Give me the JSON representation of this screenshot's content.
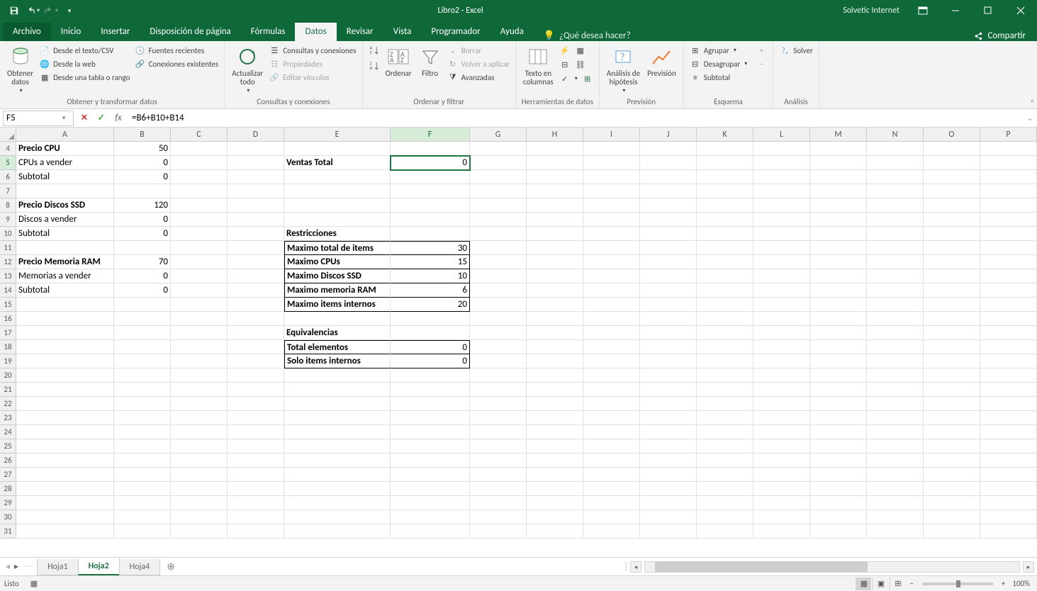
{
  "app": {
    "title": "Libro2 - Excel",
    "user": "Solvetic Internet"
  },
  "tabs": {
    "archivo": "Archivo",
    "inicio": "Inicio",
    "insertar": "Insertar",
    "diseno": "Disposición de página",
    "formulas": "Fórmulas",
    "datos": "Datos",
    "revisar": "Revisar",
    "vista": "Vista",
    "programador": "Programador",
    "ayuda": "Ayuda",
    "tellme": "¿Qué desea hacer?",
    "compartir": "Compartir"
  },
  "ribbon": {
    "obtener": {
      "obtener": "Obtener\ndatos",
      "csv": "Desde el texto/CSV",
      "web": "Desde la web",
      "tabla": "Desde una tabla o rango",
      "recientes": "Fuentes recientes",
      "existentes": "Conexiones existentes",
      "label": "Obtener y transformar datos"
    },
    "conex": {
      "actualizar": "Actualizar\ntodo",
      "consultas": "Consultas y conexiones",
      "props": "Propiedades",
      "vinculos": "Editar vínculos",
      "label": "Consultas y conexiones"
    },
    "ordenar_filtrar": {
      "ordenar": "Ordenar",
      "filtro": "Filtro",
      "borrar": "Borrar",
      "reaplicar": "Volver a aplicar",
      "avanzadas": "Avanzadas",
      "label": "Ordenar y filtrar"
    },
    "herramientas": {
      "texto": "Texto en\ncolumnas",
      "label": "Herramientas de datos"
    },
    "prevision": {
      "analisis": "Análisis de\nhipótesis",
      "prev": "Previsión",
      "label": "Previsión"
    },
    "esquema": {
      "agrupar": "Agrupar",
      "desagrupar": "Desagrupar",
      "subtotal": "Subtotal",
      "label": "Esquema"
    },
    "analisis_g": {
      "solver": "Solver",
      "label": "Análisis"
    }
  },
  "name_box": "F5",
  "formula": "=B6+B10+B14",
  "columns": [
    "A",
    "B",
    "C",
    "D",
    "E",
    "F",
    "G",
    "H",
    "I",
    "J",
    "K",
    "L",
    "M",
    "N",
    "O",
    "P"
  ],
  "col_widths": {
    "A": 138,
    "E": 150,
    "F": 112,
    "default": 80
  },
  "visible_rows": [
    4,
    5,
    6,
    7,
    8,
    9,
    10,
    11,
    12,
    13,
    14,
    15,
    16,
    17,
    18,
    19,
    20,
    21,
    22,
    23,
    24,
    25,
    26,
    27,
    28,
    29,
    30,
    31
  ],
  "selected_cell": {
    "row": 5,
    "col": "F"
  },
  "cells": {
    "A4": {
      "v": "Precio CPU",
      "b": 1
    },
    "B4": {
      "v": "50",
      "n": 1
    },
    "A5": {
      "v": "CPUs a vender"
    },
    "B5": {
      "v": "0",
      "n": 1
    },
    "E5": {
      "v": "Ventas Total",
      "b": 1
    },
    "F5": {
      "v": "0",
      "n": 1
    },
    "A6": {
      "v": "Subtotal"
    },
    "B6": {
      "v": "0",
      "n": 1
    },
    "A8": {
      "v": "Precio Discos SSD",
      "b": 1
    },
    "B8": {
      "v": "120",
      "n": 1
    },
    "A9": {
      "v": "Discos  a vender"
    },
    "B9": {
      "v": "0",
      "n": 1
    },
    "A10": {
      "v": "Subtotal"
    },
    "B10": {
      "v": "0",
      "n": 1
    },
    "E10": {
      "v": "Restricciones",
      "b": 1
    },
    "E11": {
      "v": "Maximo total de items",
      "b": 1,
      "box": "tlb"
    },
    "F11": {
      "v": "30",
      "n": 1,
      "box": "trb"
    },
    "A12": {
      "v": "Precio  Memoria RAM",
      "b": 1
    },
    "B12": {
      "v": "70",
      "n": 1
    },
    "E12": {
      "v": "Maximo CPUs",
      "b": 1,
      "box": "lb"
    },
    "F12": {
      "v": "15",
      "n": 1,
      "box": "rb"
    },
    "A13": {
      "v": "Memorias a vender"
    },
    "B13": {
      "v": "0",
      "n": 1
    },
    "E13": {
      "v": "Maximo Discos SSD",
      "b": 1,
      "box": "lb"
    },
    "F13": {
      "v": "10",
      "n": 1,
      "box": "rb"
    },
    "A14": {
      "v": "Subtotal"
    },
    "B14": {
      "v": "0",
      "n": 1
    },
    "E14": {
      "v": "Maximo memoria RAM",
      "b": 1,
      "box": "lb"
    },
    "F14": {
      "v": "6",
      "n": 1,
      "box": "rb"
    },
    "E15": {
      "v": "Maximo items internos",
      "b": 1,
      "box": "lbb"
    },
    "F15": {
      "v": "20",
      "n": 1,
      "box": "rbb"
    },
    "E17": {
      "v": "Equivalencias",
      "b": 1
    },
    "E18": {
      "v": "Total elementos",
      "b": 1,
      "box": "tlb"
    },
    "F18": {
      "v": "0",
      "n": 1,
      "box": "trb"
    },
    "E19": {
      "v": "Solo items internos",
      "b": 1,
      "box": "lbb"
    },
    "F19": {
      "v": "0",
      "n": 1,
      "box": "rbb"
    }
  },
  "sheets": {
    "hoja1": "Hoja1",
    "hoja2": "Hoja2",
    "hoja4": "Hoja4"
  },
  "status": {
    "listo": "Listo",
    "zoom": "100%"
  }
}
